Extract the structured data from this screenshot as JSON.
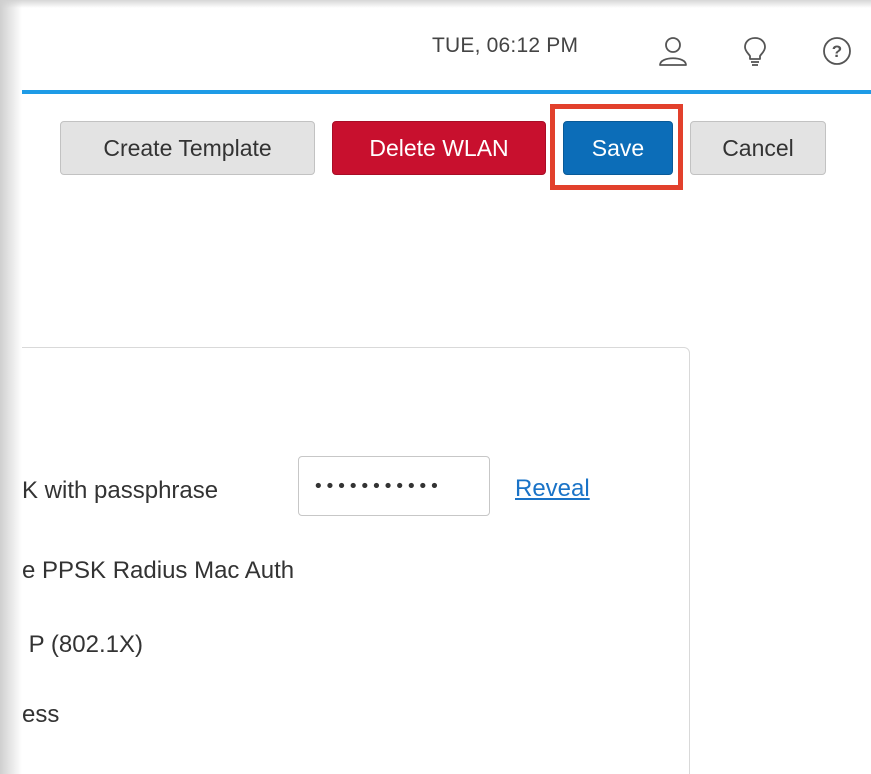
{
  "header": {
    "datetime": "TUE, 06:12 PM",
    "icons": [
      "user-icon",
      "lightbulb-icon",
      "help-icon"
    ],
    "accent_color": "#1e9be6"
  },
  "toolbar": {
    "create_template_label": "Create Template",
    "delete_wlan_label": "Delete WLAN",
    "save_label": "Save",
    "cancel_label": "Cancel",
    "highlight_color": "#e2402c",
    "delete_color": "#c8102e",
    "save_color": "#0c6db8"
  },
  "security": {
    "options": [
      {
        "label": "K with passphrase"
      },
      {
        "label": "e PPSK Radius Mac Auth"
      },
      {
        "label": " P (802.1X)"
      },
      {
        "label": "ess"
      }
    ],
    "passphrase_value": "•••••••••••",
    "reveal_label": "Reveal"
  }
}
